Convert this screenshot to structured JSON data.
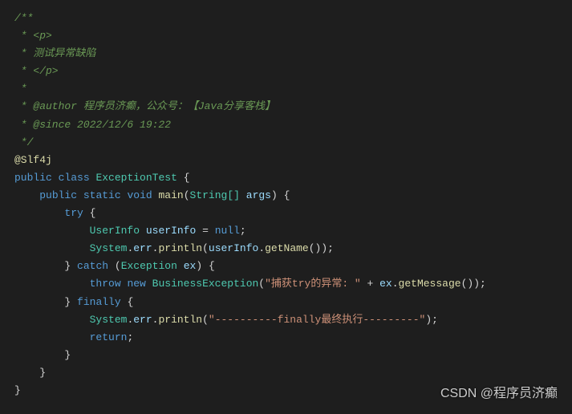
{
  "code": {
    "javadoc_open": "/**",
    "javadoc_p_open": " * <p>",
    "javadoc_desc": " * 测试异常缺陷",
    "javadoc_p_close": " * </p>",
    "javadoc_empty": " *",
    "javadoc_author_tag": " * @author",
    "javadoc_author_text": " 程序员济癫，公众号：【Java分享客栈】",
    "javadoc_since_tag": " * @since",
    "javadoc_since_text": " 2022/12/6 19:22",
    "javadoc_close": " */",
    "annotation": "@Slf4j",
    "kw_public": "public",
    "kw_class": "class",
    "class_name": "ExceptionTest",
    "kw_static": "static",
    "kw_void": "void",
    "method_main": "main",
    "type_string_arr": "String[]",
    "param_args": "args",
    "kw_try": "try",
    "type_userinfo": "UserInfo",
    "var_userinfo": "userInfo",
    "kw_null": "null",
    "obj_system": "System",
    "field_err": "err",
    "method_println": "println",
    "method_getname": "getName",
    "kw_catch": "catch",
    "type_exception": "Exception",
    "param_ex": "ex",
    "kw_throw": "throw",
    "kw_new": "new",
    "type_bizexception": "BusinessException",
    "string_catch": "\"捕获try的异常: \"",
    "method_getmessage": "getMessage",
    "kw_finally": "finally",
    "string_finally": "\"----------finally最终执行---------\"",
    "kw_return": "return",
    "brace_open": "{",
    "brace_close": "}",
    "paren_open": "(",
    "paren_close": ")",
    "semicolon": ";",
    "equals": " = ",
    "plus": " + ",
    "dot": "."
  },
  "watermark": "CSDN @程序员济癫"
}
